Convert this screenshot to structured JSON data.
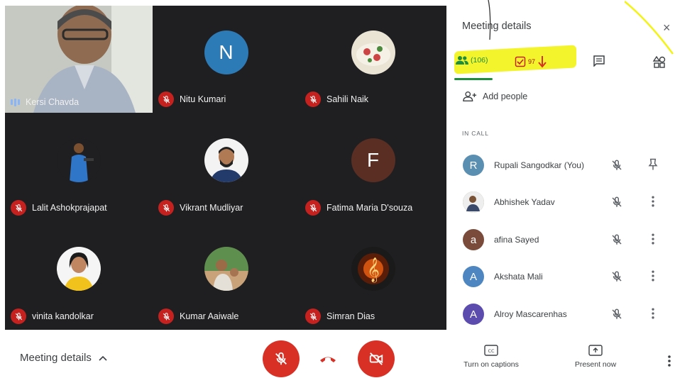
{
  "grid": {
    "tiles": [
      {
        "name": "Kersi Chavda"
      },
      {
        "name": "Nitu Kumari",
        "initial": "N",
        "color": "#2c7bb6"
      },
      {
        "name": "Sahili Naik"
      },
      {
        "name": "Lalit Ashokprajapat"
      },
      {
        "name": "Vikrant Mudliyar"
      },
      {
        "name": "Fatima Maria D'souza",
        "initial": "F",
        "color": "#5a2e22"
      },
      {
        "name": "vinita kandolkar"
      },
      {
        "name": "Kumar Aaiwale"
      },
      {
        "name": "Simran Dias"
      }
    ]
  },
  "bottom_bar": {
    "meeting_details_label": "Meeting details",
    "accent": "#d93025"
  },
  "panel": {
    "title": "Meeting details",
    "close_glyph": "×",
    "people_count": "(106)",
    "activities_count": "97",
    "add_people": "Add people",
    "in_call_label": "IN CALL",
    "participants": [
      {
        "initial": "R",
        "name": "Rupali Sangodkar (You)",
        "color": "#5b8fb1"
      },
      {
        "initial": "",
        "name": "Abhishek Yadav",
        "color": "#6d7b4e"
      },
      {
        "initial": "a",
        "name": "afina Sayed",
        "color": "#7a4b3a"
      },
      {
        "initial": "A",
        "name": "Akshata Mali",
        "color": "#4d86c0"
      },
      {
        "initial": "A",
        "name": "Alroy Mascarenhas",
        "color": "#5c4cae"
      }
    ],
    "captions_label": "Turn on captions",
    "present_label": "Present now",
    "highlight_color": "#f3f315"
  }
}
